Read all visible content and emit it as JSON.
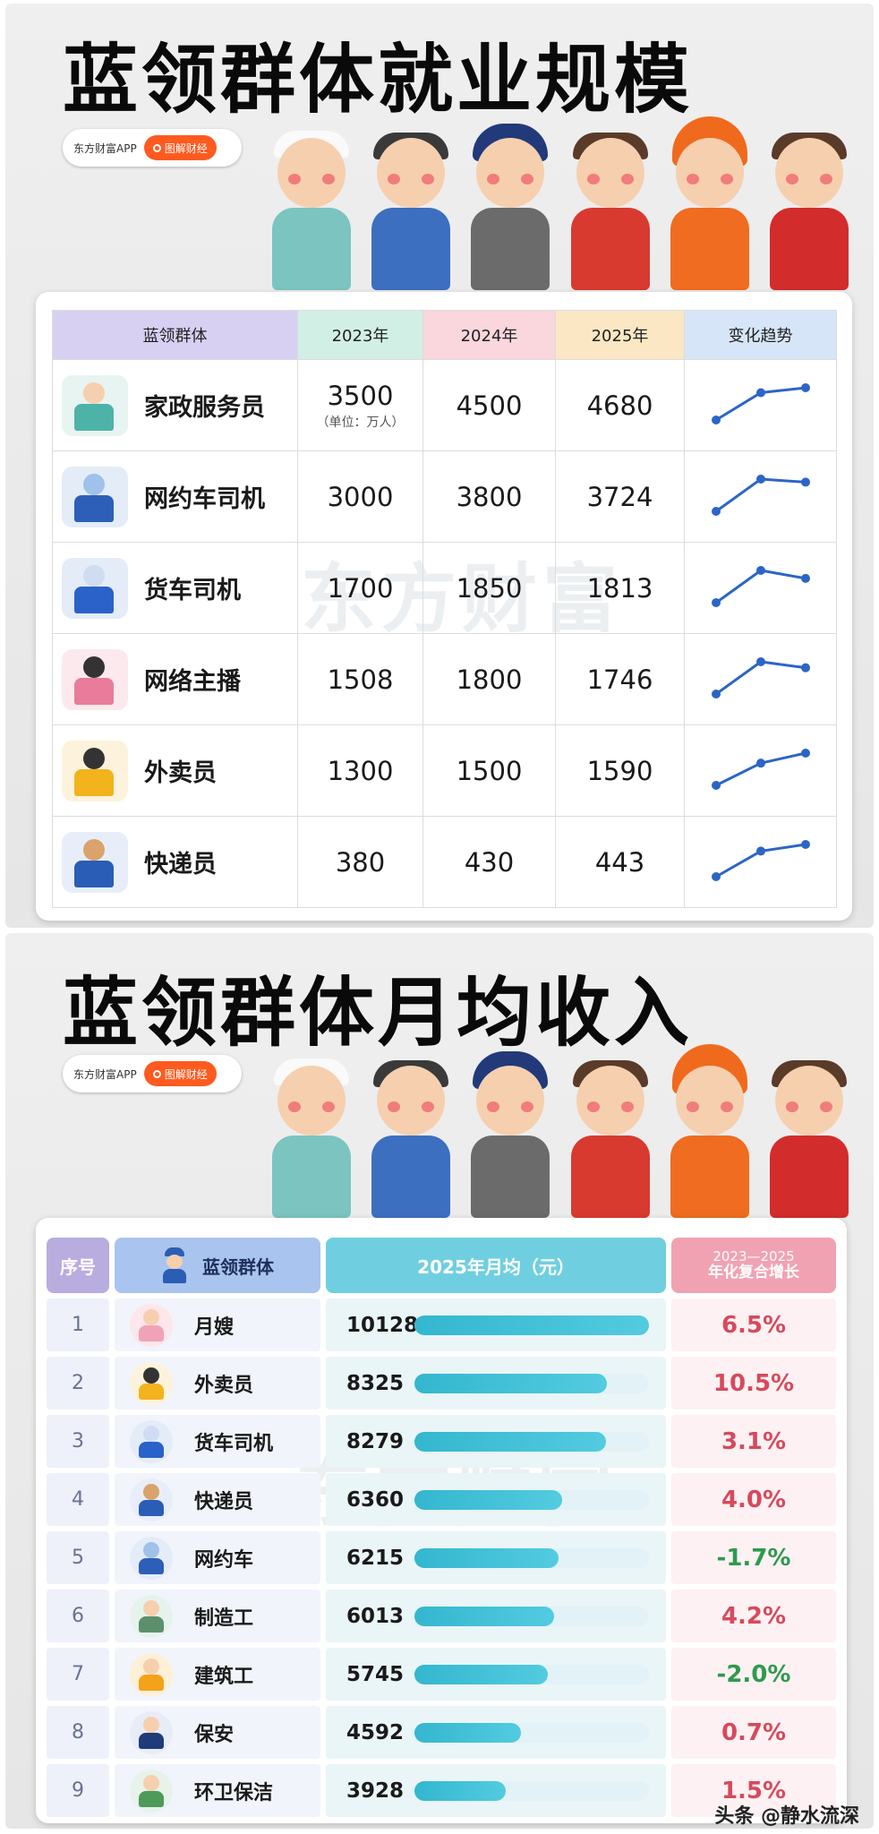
{
  "section1": {
    "title": "蓝领群体就业规模",
    "brand": "东方财富APP",
    "tag": "图解财经",
    "watermark": "东方财富",
    "headers": [
      "蓝领群体",
      "2023年",
      "2024年",
      "2025年",
      "变化趋势"
    ],
    "unit_note": "（单位：万人）",
    "rows": [
      {
        "name": "家政服务员",
        "icon": "housekeeper-icon",
        "v2023": "3500",
        "v2024": "4500",
        "v2025": "4680"
      },
      {
        "name": "网约车司机",
        "icon": "ride-hailing-car-icon",
        "v2023": "3000",
        "v2024": "3800",
        "v2025": "3724"
      },
      {
        "name": "货车司机",
        "icon": "truck-icon",
        "v2023": "1700",
        "v2024": "1850",
        "v2025": "1813"
      },
      {
        "name": "网络主播",
        "icon": "livestreamer-icon",
        "v2023": "1508",
        "v2024": "1800",
        "v2025": "1746"
      },
      {
        "name": "外卖员",
        "icon": "delivery-scooter-icon",
        "v2023": "1300",
        "v2024": "1500",
        "v2025": "1590"
      },
      {
        "name": "快递员",
        "icon": "courier-icon",
        "v2023": "380",
        "v2024": "430",
        "v2025": "443"
      }
    ]
  },
  "section2": {
    "title": "蓝领群体月均收入",
    "brand": "东方财富APP",
    "tag": "图解财经",
    "watermark": "东方财富",
    "headers": {
      "rank": "序号",
      "group": "蓝领群体",
      "income": "2025年月均（元）",
      "growth_line1": "2023—2025",
      "growth_line2": "年化复合增长"
    },
    "rows": [
      {
        "rank": "1",
        "name": "月嫂",
        "icon": "nanny-icon",
        "income": "10128",
        "growth": "6.5%"
      },
      {
        "rank": "2",
        "name": "外卖员",
        "icon": "delivery-scooter-icon",
        "income": "8325",
        "growth": "10.5%"
      },
      {
        "rank": "3",
        "name": "货车司机",
        "icon": "truck-icon",
        "income": "8279",
        "growth": "3.1%"
      },
      {
        "rank": "4",
        "name": "快递员",
        "icon": "courier-icon",
        "income": "6360",
        "growth": "4.0%"
      },
      {
        "rank": "5",
        "name": "网约车",
        "icon": "ride-hailing-car-icon",
        "income": "6215",
        "growth": "-1.7%"
      },
      {
        "rank": "6",
        "name": "制造工",
        "icon": "factory-worker-icon",
        "income": "6013",
        "growth": "4.2%"
      },
      {
        "rank": "7",
        "name": "建筑工",
        "icon": "construction-worker-icon",
        "income": "5745",
        "growth": "-2.0%"
      },
      {
        "rank": "8",
        "name": "保安",
        "icon": "security-guard-icon",
        "income": "4592",
        "growth": "0.7%"
      },
      {
        "rank": "9",
        "name": "环卫保洁",
        "icon": "sanitation-worker-icon",
        "income": "3928",
        "growth": "1.5%"
      }
    ]
  },
  "footer": "头条 @静水流深",
  "colors": {
    "header_purple": "#d8d0f2",
    "header_green": "#d2efe6",
    "header_pink": "#fad6dd",
    "header_yellow": "#fbe7c4",
    "header_blue": "#d6e6f8",
    "trend_line": "#2c65c6",
    "bar": "#3dbfd6",
    "growth_positive": "#d64a5c",
    "growth_negative": "#2e9a4e",
    "brand_orange": "#ff5a1f"
  }
}
